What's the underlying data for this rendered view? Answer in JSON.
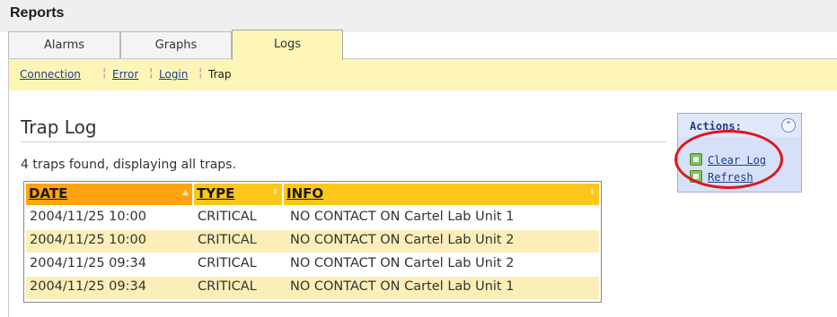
{
  "app": {
    "title": "Reports"
  },
  "tabs": [
    {
      "label": "Alarms",
      "active": false
    },
    {
      "label": "Graphs",
      "active": false
    },
    {
      "label": "Logs",
      "active": true
    }
  ],
  "subnav": {
    "items": [
      {
        "label": "Connection",
        "link": true
      },
      {
        "label": "Error",
        "link": true
      },
      {
        "label": "Login",
        "link": true
      },
      {
        "label": "Trap",
        "link": false
      }
    ]
  },
  "page": {
    "title": "Trap Log",
    "summary": "4 traps found, displaying all traps."
  },
  "table": {
    "columns": [
      {
        "label": "DATE",
        "sorted": "ascending"
      },
      {
        "label": "TYPE",
        "sorted": "none"
      },
      {
        "label": "INFO",
        "sorted": "none"
      }
    ],
    "rows": [
      {
        "date": "2004/11/25 10:00",
        "type": "CRITICAL",
        "info": "NO CONTACT ON Cartel Lab Unit 1"
      },
      {
        "date": "2004/11/25 10:00",
        "type": "CRITICAL",
        "info": "NO CONTACT ON Cartel Lab Unit 2"
      },
      {
        "date": "2004/11/25 09:34",
        "type": "CRITICAL",
        "info": "NO CONTACT ON Cartel Lab Unit 2"
      },
      {
        "date": "2004/11/25 09:34",
        "type": "CRITICAL",
        "info": "NO CONTACT ON Cartel Lab Unit 1"
      }
    ]
  },
  "actions": {
    "title": "Actions:",
    "items": [
      {
        "label": "Clear Log",
        "icon": "clear-log-icon"
      },
      {
        "label": "Refresh",
        "icon": "refresh-icon"
      }
    ]
  },
  "colors": {
    "accent_header": "#ffc61a",
    "sorted_header": "#ffa40f",
    "subnav_bg": "#fdf5b6",
    "link": "#1d3d8f",
    "annotation": "#e0151c"
  }
}
